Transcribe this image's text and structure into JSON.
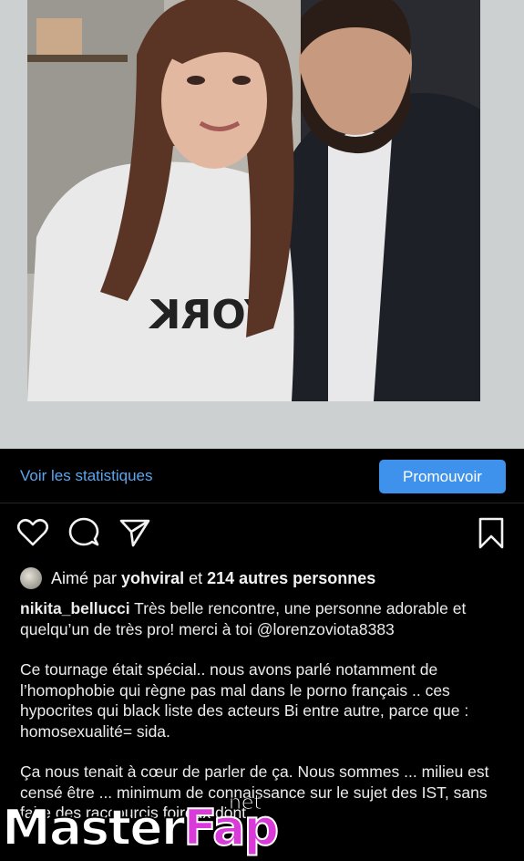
{
  "post": {
    "image_description": "selfie-photo",
    "view_stats_label": "Voir les statistiques",
    "promote_label": "Promouvoir"
  },
  "actions": {
    "like_icon": "heart-icon",
    "comment_icon": "comment-icon",
    "share_icon": "send-icon",
    "save_icon": "bookmark-icon"
  },
  "likes": {
    "prefix": "Aimé par",
    "user": "yohviral",
    "connector": "et",
    "others": "214 autres personnes"
  },
  "caption": {
    "username": "nikita_bellucci",
    "paragraph1_rest": "Très belle rencontre, une personne adorable et quelqu’un de très pro! merci à toi @lorenzoviota8383",
    "paragraph2": "Ce tournage était spécial.. nous avons parlé notamment de l’homophobie qui règne pas mal dans le porno français .. ces hypocrites qui black liste des acteurs Bi entre autre, parce que : homosexualité= sida.",
    "paragraph3": "Ça nous tenait à cœur de parler de ça. Nous sommes ... milieu est censé être ... minimum de connaissance sur le sujet des IST, sans faire des raccourcis foireux dont"
  },
  "watermark": {
    "part1": "Master",
    "part2": "Fap",
    "suffix": ".net"
  },
  "colors": {
    "background": "#000000",
    "link_blue": "#5aa7f0",
    "button_blue": "#3f92ec",
    "watermark_pink": "#d93ad9"
  }
}
